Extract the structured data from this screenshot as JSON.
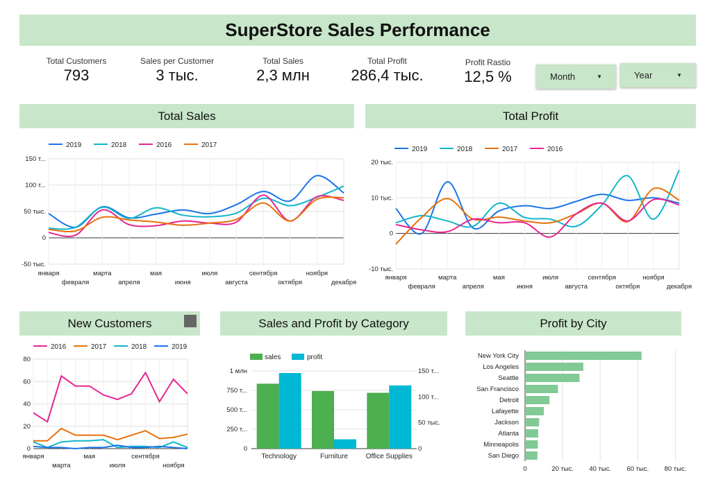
{
  "title": "SuperStore Sales Performance",
  "kpis": {
    "customers": {
      "label": "Total Customers",
      "value": "793"
    },
    "spc": {
      "label": "Sales per Customer",
      "value": "3 тыс."
    },
    "sales": {
      "label": "Total Sales",
      "value": "2,3 млн"
    },
    "profit": {
      "label": "Total Profit",
      "value": "286,4 тыс."
    },
    "ratio": {
      "label": "Profit Rastio",
      "value": "12,5 %"
    }
  },
  "filters": {
    "month": "Month",
    "year": "Year"
  },
  "sections": {
    "total_sales": "Total Sales",
    "total_profit": "Total Profit",
    "new_customers": "New Customers",
    "sales_profit_category": "Sales and Profit  by Category",
    "profit_by_city": "Profit  by City"
  },
  "colors": {
    "2019": "#1a73e8",
    "2018": "#12b5cb",
    "2017": "#e8710a",
    "2016": "#e52592",
    "sales_bar": "#4caf50",
    "profit_bar": "#00b8d4",
    "city_bar": "#81c995",
    "banner": "#c8e6c9"
  },
  "chart_data": [
    {
      "id": "total_sales",
      "type": "line",
      "months": [
        "января",
        "февраля",
        "марта",
        "апреля",
        "мая",
        "июня",
        "июля",
        "августа",
        "сентября",
        "октября",
        "ноября",
        "декабря"
      ],
      "y_ticks": [
        "150 т...",
        "100 т...",
        "50 тыс.",
        "0",
        "-50 тыс."
      ],
      "ylim": [
        -50000,
        150000
      ],
      "legend_position": "top",
      "series": [
        {
          "name": "2019",
          "values": [
            46000,
            20000,
            59000,
            38000,
            45000,
            53000,
            46000,
            63000,
            88000,
            70000,
            118000,
            85000
          ]
        },
        {
          "name": "2018",
          "values": [
            18000,
            20000,
            58000,
            37000,
            57000,
            43000,
            40000,
            47000,
            75000,
            61000,
            77000,
            98000
          ]
        },
        {
          "name": "2016",
          "values": [
            10000,
            5000,
            53000,
            25000,
            23000,
            32000,
            28000,
            30000,
            81000,
            32000,
            78000,
            71000
          ]
        },
        {
          "name": "2017",
          "values": [
            16000,
            13000,
            39000,
            34000,
            30000,
            24000,
            28000,
            35000,
            66000,
            32000,
            73000,
            76000
          ]
        }
      ]
    },
    {
      "id": "total_profit",
      "type": "line",
      "months": [
        "января",
        "февраля",
        "марта",
        "апреля",
        "мая",
        "июня",
        "июля",
        "августа",
        "сентября",
        "октября",
        "ноября",
        "декабря"
      ],
      "y_ticks": [
        "20 тыс.",
        "10 тыс.",
        "0",
        "-10 тыс."
      ],
      "ylim": [
        -10000,
        20000
      ],
      "legend_position": "top",
      "series": [
        {
          "name": "2019",
          "values": [
            7000,
            0,
            14500,
            1500,
            6300,
            7800,
            7000,
            9000,
            11000,
            9300,
            10000,
            8500
          ]
        },
        {
          "name": "2018",
          "values": [
            3000,
            5000,
            3500,
            2000,
            8500,
            4500,
            4000,
            2000,
            8000,
            16200,
            4000,
            17800
          ]
        },
        {
          "name": "2017",
          "values": [
            -3000,
            4500,
            9800,
            4000,
            4600,
            3500,
            3000,
            5500,
            8500,
            3300,
            12600,
            9300
          ]
        },
        {
          "name": "2016",
          "values": [
            2500,
            1000,
            500,
            4000,
            3000,
            3000,
            -1000,
            5500,
            8500,
            3500,
            9500,
            8000
          ]
        }
      ]
    },
    {
      "id": "new_customers",
      "type": "line",
      "x_ticks": [
        "января",
        "марта",
        "мая",
        "июля",
        "сентября",
        "ноября"
      ],
      "y_ticks": [
        "80",
        "60",
        "40",
        "20",
        "0"
      ],
      "ylim": [
        0,
        80
      ],
      "legend_position": "top",
      "series": [
        {
          "name": "2016",
          "values": [
            32,
            24,
            65,
            56,
            56,
            48,
            44,
            49,
            68,
            42,
            62,
            49
          ]
        },
        {
          "name": "2017",
          "values": [
            7,
            7,
            18,
            12,
            12,
            12,
            8,
            12,
            16,
            9,
            10,
            13
          ]
        },
        {
          "name": "2018",
          "values": [
            6,
            1,
            6,
            7,
            7,
            8,
            1,
            2,
            2,
            1,
            6,
            1
          ]
        },
        {
          "name": "2019",
          "values": [
            2,
            1,
            1,
            0,
            1,
            1,
            3,
            1,
            1,
            2,
            1,
            0
          ]
        }
      ]
    },
    {
      "id": "sales_profit_category",
      "type": "bar",
      "categories": [
        "Technology",
        "Furniture",
        "Office Supplies"
      ],
      "series": [
        {
          "name": "sales",
          "values": [
            836000,
            742000,
            719000
          ]
        },
        {
          "name": "profit",
          "values": [
            146000,
            18000,
            122000
          ]
        }
      ],
      "left_ticks": [
        "1 млн",
        "750 т...",
        "500 т...",
        "250 т...",
        "0"
      ],
      "right_ticks": [
        "150 т...",
        "100 т...",
        "50 тыс.",
        "0"
      ],
      "ylim_left": [
        0,
        1000000
      ],
      "ylim_right": [
        0,
        150000
      ],
      "legend_position": "top"
    },
    {
      "id": "profit_by_city",
      "type": "bar",
      "orientation": "horizontal",
      "categories": [
        "New York City",
        "Los Angeles",
        "Seattle",
        "San Francisco",
        "Detroit",
        "Lafayette",
        "Jackson",
        "Atlanta",
        "Minneapolis",
        "San Diego"
      ],
      "values": [
        62000,
        31000,
        29000,
        17500,
        13000,
        10000,
        7500,
        7000,
        6800,
        6600
      ],
      "x_ticks": [
        "0",
        "20 тыс.",
        "40 тыс.",
        "60 тыс.",
        "80 тыс."
      ],
      "xlim": [
        0,
        85000
      ]
    }
  ]
}
